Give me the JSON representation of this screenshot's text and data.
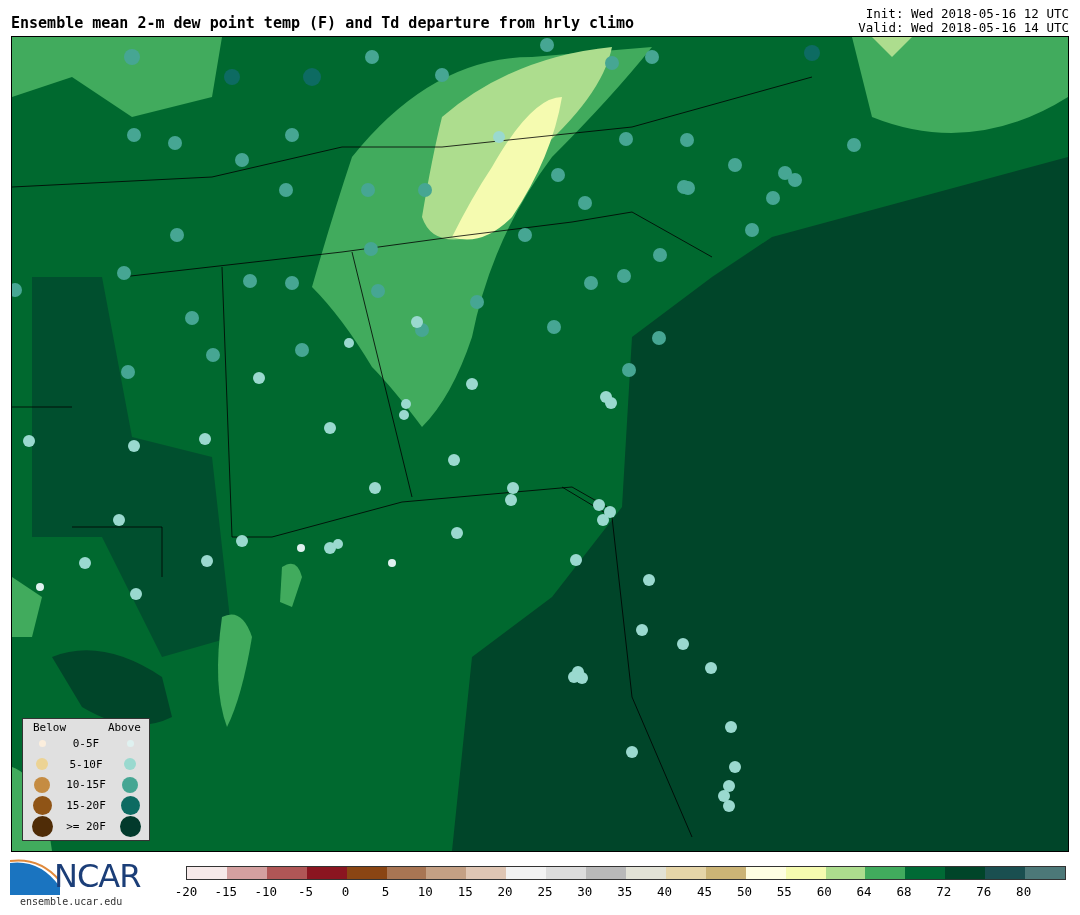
{
  "title": "Ensemble mean 2-m dew point temp (F) and Td departure from hrly climo",
  "init": "Init: Wed 2018-05-16 12 UTC",
  "valid": "Valid: Wed 2018-05-16 14 UTC",
  "legend": {
    "below_heading": "Below",
    "above_heading": "Above",
    "rows": [
      {
        "label": "0-5F",
        "below": {
          "color": "#fbeedd"
        },
        "above": {
          "color": "#dff1f0"
        }
      },
      {
        "label": "5-10F",
        "below": {
          "color": "#ecd394"
        },
        "above": {
          "color": "#9ad9cf"
        }
      },
      {
        "label": "10-15F",
        "below": {
          "color": "#c58c42"
        },
        "above": {
          "color": "#46a693"
        }
      },
      {
        "label": "15-20F",
        "below": {
          "color": "#8f5416"
        },
        "above": {
          "color": "#0d6b62"
        }
      },
      {
        "label": ">= 20F",
        "below": {
          "color": "#4f2c07"
        },
        "above": {
          "color": "#023a2c"
        }
      }
    ]
  },
  "logo": {
    "text": "NCAR",
    "url": "ensemble.ucar.edu"
  },
  "colorbar": {
    "segments": [
      {
        "color": "#f6e9e9"
      },
      {
        "color": "#d4a0a0"
      },
      {
        "color": "#b05656"
      },
      {
        "color": "#8b1520"
      },
      {
        "color": "#8a4513"
      },
      {
        "color": "#a87553"
      },
      {
        "color": "#c4a084"
      },
      {
        "color": "#dfc6b4"
      },
      {
        "color": "#f2f2f2"
      },
      {
        "color": "#dcdcdc"
      },
      {
        "color": "#b9b9b9"
      },
      {
        "color": "#e2e2d6"
      },
      {
        "color": "#e5d5a8"
      },
      {
        "color": "#cbb476"
      },
      {
        "color": "#fefee2"
      },
      {
        "color": "#f5fbb0"
      },
      {
        "color": "#addd8e"
      },
      {
        "color": "#41ab5d"
      },
      {
        "color": "#006a35"
      },
      {
        "color": "#004529"
      },
      {
        "color": "#1a4f50"
      },
      {
        "color": "#4c7878"
      }
    ],
    "ticks": [
      "-20",
      "-15",
      "-10",
      "-5",
      "0",
      "5",
      "10",
      "15",
      "20",
      "25",
      "30",
      "35",
      "40",
      "45",
      "50",
      "55",
      "60",
      "64",
      "68",
      "72",
      "76",
      "80"
    ]
  }
}
